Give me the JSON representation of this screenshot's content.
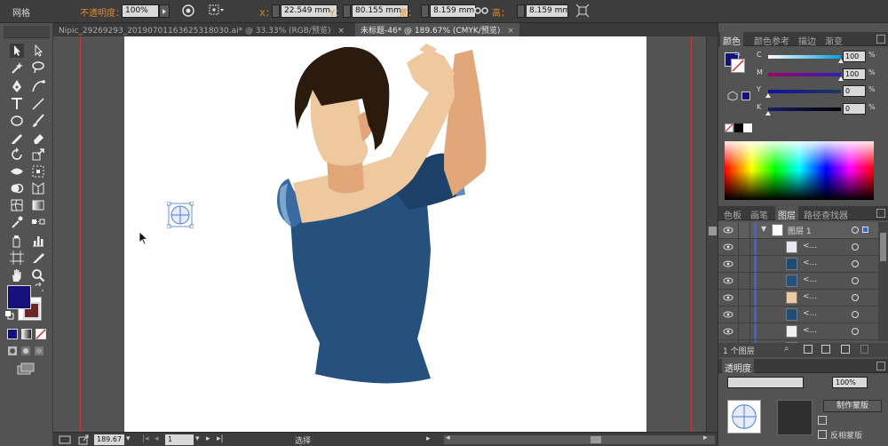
{
  "control_bar": {
    "mode_label": "网格",
    "opacity_label": "不透明度：",
    "opacity_value": "100%",
    "x_label": "X：",
    "x_value": "22.549 mm",
    "y_label": "Y：",
    "y_value": "80.155 mm",
    "width_label": "宽：",
    "width_value": "8.159 mm",
    "height_label": "高：",
    "height_value": "8.159 mm"
  },
  "doc_tabs": [
    {
      "label": "Nipic_29269293_20190701163625318030.ai* @ 33.33% (RGB/预览)",
      "close": "×",
      "active": false
    },
    {
      "label": "未标题-46* @ 189.67% (CMYK/预览)",
      "close": "×",
      "active": true
    }
  ],
  "status_bar": {
    "zoom": "189.67",
    "artboard": "1",
    "tool": "选择"
  },
  "color_panel": {
    "tabs": [
      "颜色",
      "颜色参考",
      "描边",
      "渐变"
    ],
    "active_tab": "颜色",
    "sliders": [
      {
        "label": "C",
        "value": "100",
        "unit": "%",
        "fill": 1.0,
        "gradient": [
          "#ffffff",
          "#00a0e0"
        ]
      },
      {
        "label": "M",
        "value": "100",
        "unit": "%",
        "fill": 1.0,
        "gradient": [
          "#a00070",
          "#3020b0"
        ]
      },
      {
        "label": "Y",
        "value": "0",
        "unit": "%",
        "fill": 0.0,
        "gradient": [
          "#1010a0",
          "#1a3a5a"
        ]
      },
      {
        "label": "K",
        "value": "0",
        "unit": "%",
        "fill": 0.0,
        "gradient": [
          "#1a1a6a",
          "#000000"
        ]
      }
    ],
    "fill_color": "#16107a"
  },
  "layers_panel": {
    "tabs": [
      "色板",
      "画笔",
      "图层",
      "路径查找器"
    ],
    "active_tab": "图层",
    "layer_name": "图层 1",
    "sublayers": [
      {
        "name": "<...",
        "thumb_color": "#e8e8f0"
      },
      {
        "name": "<...",
        "thumb_color": "#1f4a70"
      },
      {
        "name": "<...",
        "thumb_color": "#27507d"
      },
      {
        "name": "<...",
        "thumb_color": "#eec9a0"
      },
      {
        "name": "<...",
        "thumb_color": "#244b73"
      },
      {
        "name": "<...",
        "thumb_color": "#f0f0f0"
      },
      {
        "name": "<...",
        "thumb_color": "#23486f"
      }
    ],
    "count_label": "1 个图层"
  },
  "transparency_panel": {
    "tab": "透明度",
    "opacity": "100%",
    "make_mask": "制作蒙版",
    "invert_mask": "反相蒙版"
  },
  "colors": {
    "ui_dark": "#3d3d3d",
    "ui_mid": "#535353",
    "guide": "#c73a3a",
    "shirt": "#26507e",
    "shirt_dark": "#1d4168",
    "skin": "#eec9a0",
    "skin_dark": "#e1a779",
    "hair": "#2b1a0e"
  }
}
